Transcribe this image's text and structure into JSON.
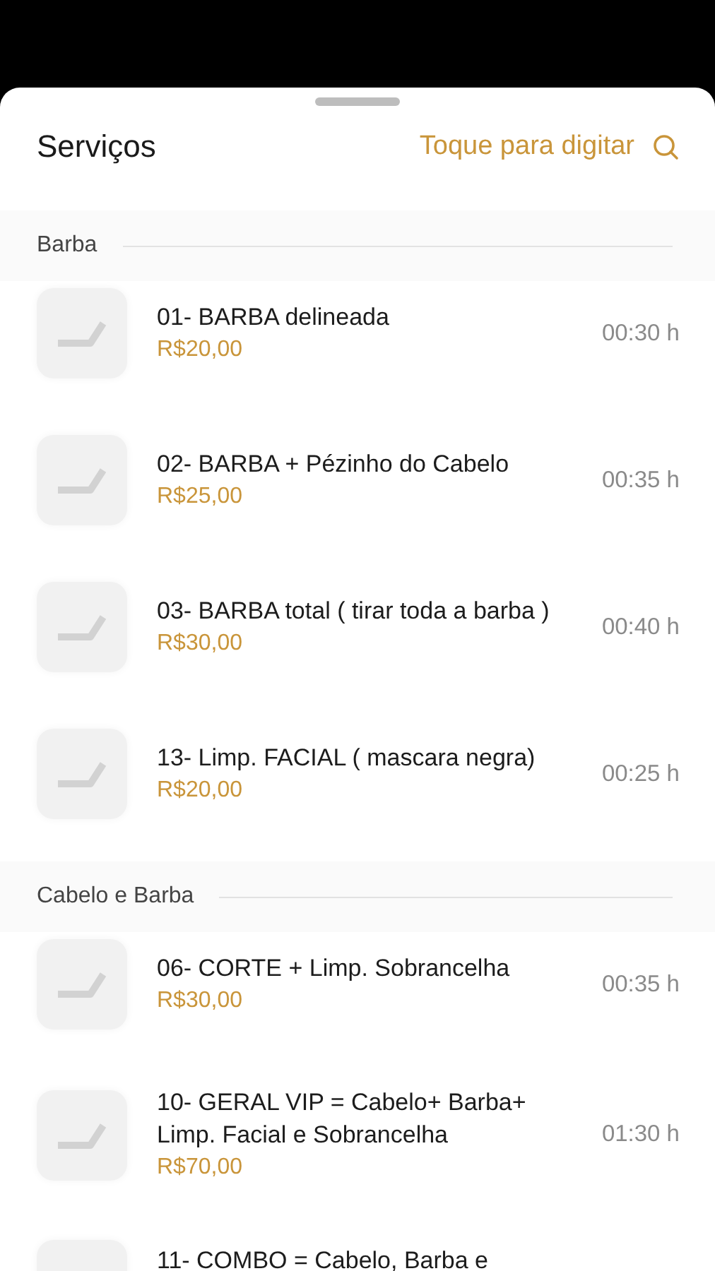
{
  "header": {
    "title": "Serviços",
    "search": {
      "placeholder": "Toque para digitar"
    }
  },
  "sections": [
    {
      "name": "Barba",
      "services": [
        {
          "title": "01- BARBA delineada",
          "price": "R$20,00",
          "duration": "00:30 h"
        },
        {
          "title": "02- BARBA + Pézinho do Cabelo",
          "price": "R$25,00",
          "duration": "00:35 h"
        },
        {
          "title": "03- BARBA total ( tirar toda a barba )",
          "price": "R$30,00",
          "duration": "00:40 h"
        },
        {
          "title": "13- Limp. FACIAL ( mascara negra)",
          "price": "R$20,00",
          "duration": "00:25 h"
        }
      ]
    },
    {
      "name": "Cabelo e Barba",
      "services": [
        {
          "title": "06- CORTE + Limp. Sobrancelha",
          "price": "R$30,00",
          "duration": "00:35 h"
        },
        {
          "title": "10- GERAL VIP = Cabelo+ Barba+ Limp. Facial e Sobrancelha",
          "price": "R$70,00",
          "duration": "01:30 h"
        },
        {
          "title": "11- COMBO = Cabelo, Barba e"
        }
      ]
    }
  ]
}
